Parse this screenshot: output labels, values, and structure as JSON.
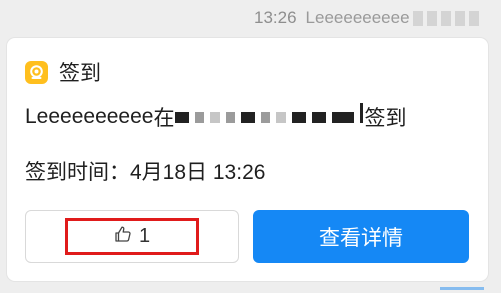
{
  "message": {
    "time": "13:26",
    "sender": "Leeeeeeeeee"
  },
  "card": {
    "icon": "check-in-icon",
    "title": "签到",
    "user_name": "Leeeeeeeeee",
    "location_prefix": "在",
    "checkin_suffix": "签到",
    "time_label": "签到时间：",
    "time_value": "4月18日 13:26",
    "like_count": "1",
    "detail_button": "查看详情"
  },
  "colors": {
    "accent": "#1588f5",
    "icon_bg": "#ffbf1e",
    "highlight": "#e01b1b"
  }
}
